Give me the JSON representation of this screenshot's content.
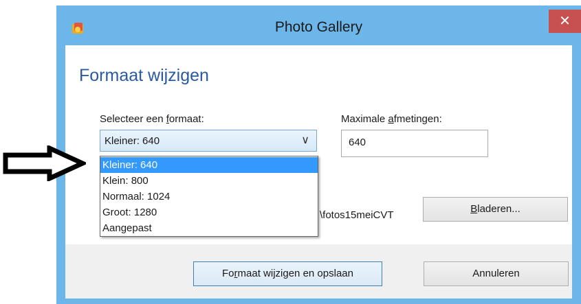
{
  "window": {
    "title": "Photo Gallery",
    "close_label": "✕"
  },
  "dialog": {
    "heading": "Formaat wijzigen",
    "format_label_pre": "Selecteer een ",
    "format_label_u": "f",
    "format_label_post": "ormaat:",
    "max_label_pre": "Maximale ",
    "max_label_u": "a",
    "max_label_post": "fmetingen:",
    "combo_value": "Kleiner: 640",
    "max_value": "640",
    "path_text": "\\fotos15meiCVT",
    "browse_u": "B",
    "browse_post": "laderen...",
    "ok_pre": "Fo",
    "ok_u": "r",
    "ok_post": "maat wijzigen en opslaan",
    "cancel_label": "Annuleren"
  },
  "dropdown": {
    "items": [
      {
        "label": "Kleiner: 640",
        "selected": true
      },
      {
        "label": "Klein: 800"
      },
      {
        "label": "Normaal: 1024"
      },
      {
        "label": "Groot: 1280"
      },
      {
        "label": "Aangepast"
      }
    ]
  },
  "colors": {
    "titlebar": "#6db6ea",
    "close": "#c75050",
    "heading": "#2a5aa0",
    "selection": "#3399ff"
  },
  "icons": {
    "app": "photo-gallery-icon",
    "chevron": "chevron-down-icon",
    "annotation": "right-arrow-icon"
  }
}
